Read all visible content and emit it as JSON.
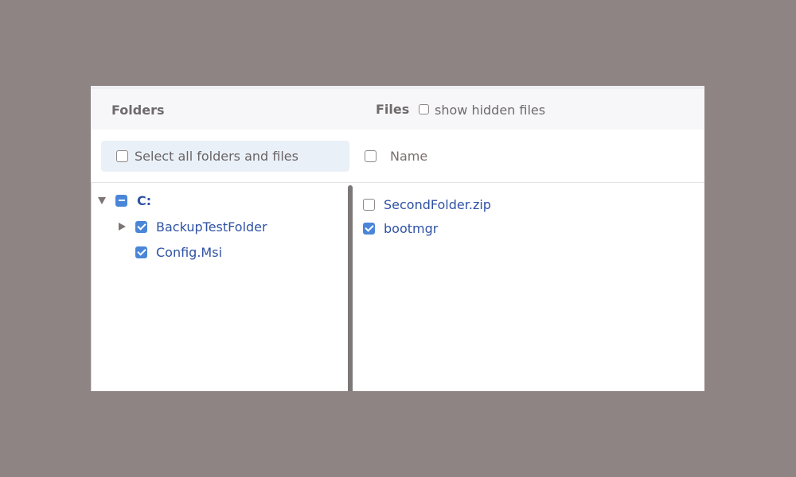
{
  "header": {
    "folders_title": "Folders",
    "files_title": "Files",
    "show_hidden_label": "show hidden files",
    "show_hidden_checked": false
  },
  "select_all": {
    "label": "Select all folders and files",
    "checked": false
  },
  "files_header": {
    "name_label": "Name",
    "checked": false
  },
  "folder_tree": [
    {
      "label": "C:",
      "state": "partial",
      "expanded": true,
      "level": 0
    },
    {
      "label": "BackupTestFolder",
      "state": "checked",
      "expanded": false,
      "level": 1
    },
    {
      "label": "Config.Msi",
      "state": "checked",
      "level": 1
    }
  ],
  "files": [
    {
      "name": "SecondFolder.zip",
      "checked": false
    },
    {
      "name": "bootmgr",
      "checked": true
    }
  ],
  "colors": {
    "background": "#8e8483",
    "accent": "#4a86d8",
    "link_text": "#2f52a4"
  },
  "icons": [
    "expand-down-arrow-icon",
    "expand-right-arrow-icon",
    "checkbox-icon"
  ]
}
